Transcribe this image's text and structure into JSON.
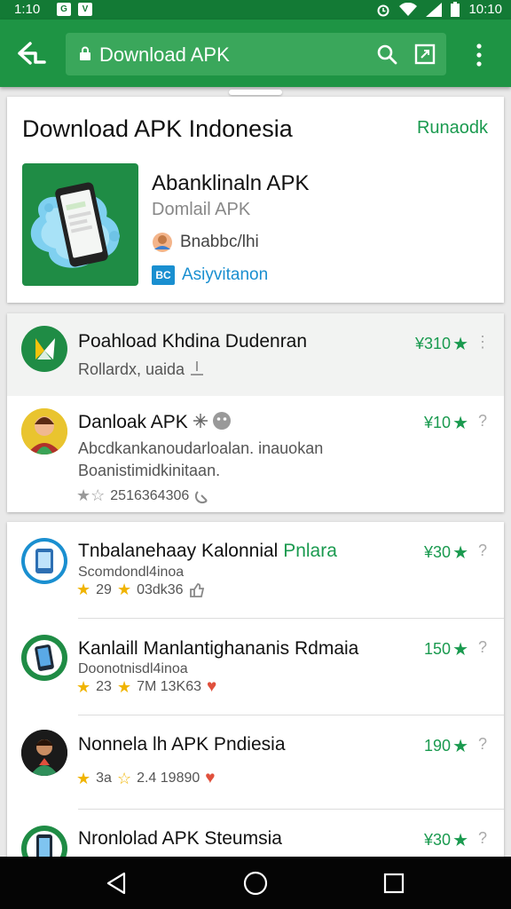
{
  "status_bar": {
    "time": "1:10",
    "clock": "10:10",
    "chip_a": "G",
    "chip_b": "V"
  },
  "toolbar": {
    "url": "Download APK"
  },
  "featured": {
    "title": "Download APK Indonesia",
    "action": "Runaodk",
    "app_name": "Abanklinaln APK",
    "app_subtitle": "Domlail APK",
    "developer": "Bnabbc/lhi",
    "tag_icon": "BC",
    "tag": "Asiyvitanon"
  },
  "list_card_1": [
    {
      "title": "Poahload Khdina Dudenran",
      "sub": "Rollardx, uaida",
      "price": "¥310",
      "more": "⋮",
      "icon": "kinemaster-logo-icon"
    },
    {
      "title": "Danloak APK",
      "sub": "Abcdkankanoudarloalan. inauokan",
      "sub2": "Boanistimidkinitaan.",
      "meta": "2516364306",
      "price": "¥10",
      "more": "?",
      "icon": "cartoon-avatar-icon"
    }
  ],
  "list_card_2": [
    {
      "title": "Tnbalanehaay Kalonnial",
      "tag": "Pnlara",
      "sub": "Scomdondl4inoa",
      "rating": "29",
      "meta": "03dk36",
      "price": "¥30",
      "more": "?",
      "icon": "phone-app-icon"
    },
    {
      "title": "Kanlaill Manlantighananis Rdmaia",
      "sub": "Doonotnisdl4inoa",
      "rating": "23",
      "meta": "7M 13K63",
      "price": "150",
      "more": "?",
      "icon": "phone-app-icon"
    },
    {
      "title": "Nonnela lh APK Pndiesia",
      "rating": "3a",
      "meta": "2.4 19890",
      "price": "190",
      "more": "?",
      "icon": "person-avatar-icon"
    },
    {
      "title": "Nronlolad APK Steumsia",
      "price": "¥30",
      "more": "?",
      "icon": "phone-app-icon"
    }
  ],
  "colors": {
    "status_bar": "#137a35",
    "app_bar": "#1e9444",
    "accent": "#1a9a4f",
    "link_blue": "#1a8fd0"
  }
}
